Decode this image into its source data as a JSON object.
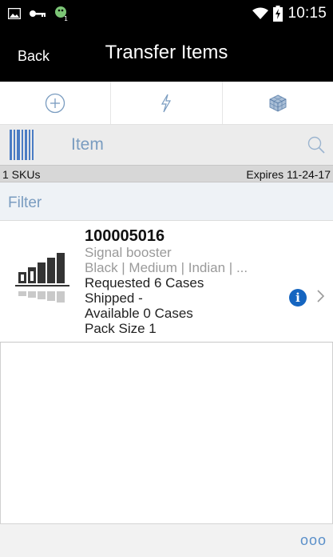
{
  "status_bar": {
    "time": "10:15",
    "icons": [
      "image-icon",
      "key-icon",
      "android-notification-icon",
      "wifi-icon",
      "battery-charging-icon"
    ]
  },
  "header": {
    "back_label": "Back",
    "title": "Transfer Items"
  },
  "toolbar": {
    "buttons": [
      {
        "icon": "add-circle-icon"
      },
      {
        "icon": "lightning-icon"
      },
      {
        "icon": "cube-icon"
      }
    ]
  },
  "search": {
    "label": "Item",
    "icon": "search-icon",
    "scan_icon": "barcode-icon"
  },
  "info": {
    "sku_count": "1 SKUs",
    "expires": "Expires 11-24-17"
  },
  "filter": {
    "label": "Filter"
  },
  "items": [
    {
      "id": "100005016",
      "name": "Signal booster",
      "attributes": "Black | Medium | Indian | ...",
      "requested": "Requested 6 Cases",
      "shipped": "Shipped -",
      "available": "Available 0 Cases",
      "pack_size": "Pack Size 1",
      "info_glyph": "i"
    }
  ],
  "footer": {
    "more_label": "ooo"
  },
  "colors": {
    "accent": "#7a9cc0",
    "info_blue": "#1565c0",
    "header_bg": "#000000"
  }
}
